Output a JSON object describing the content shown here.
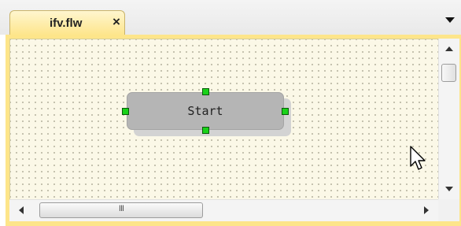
{
  "tab": {
    "label": "ifv.flw",
    "close_glyph": "×",
    "overflow_icon": "chevron-down-icon"
  },
  "canvas": {
    "background": "#fbf8e7",
    "node": {
      "label": "Start",
      "fill": "#b5b5b5",
      "handle_color": "#19d219"
    }
  },
  "scrollbars": {
    "horizontal_grip": "III"
  }
}
